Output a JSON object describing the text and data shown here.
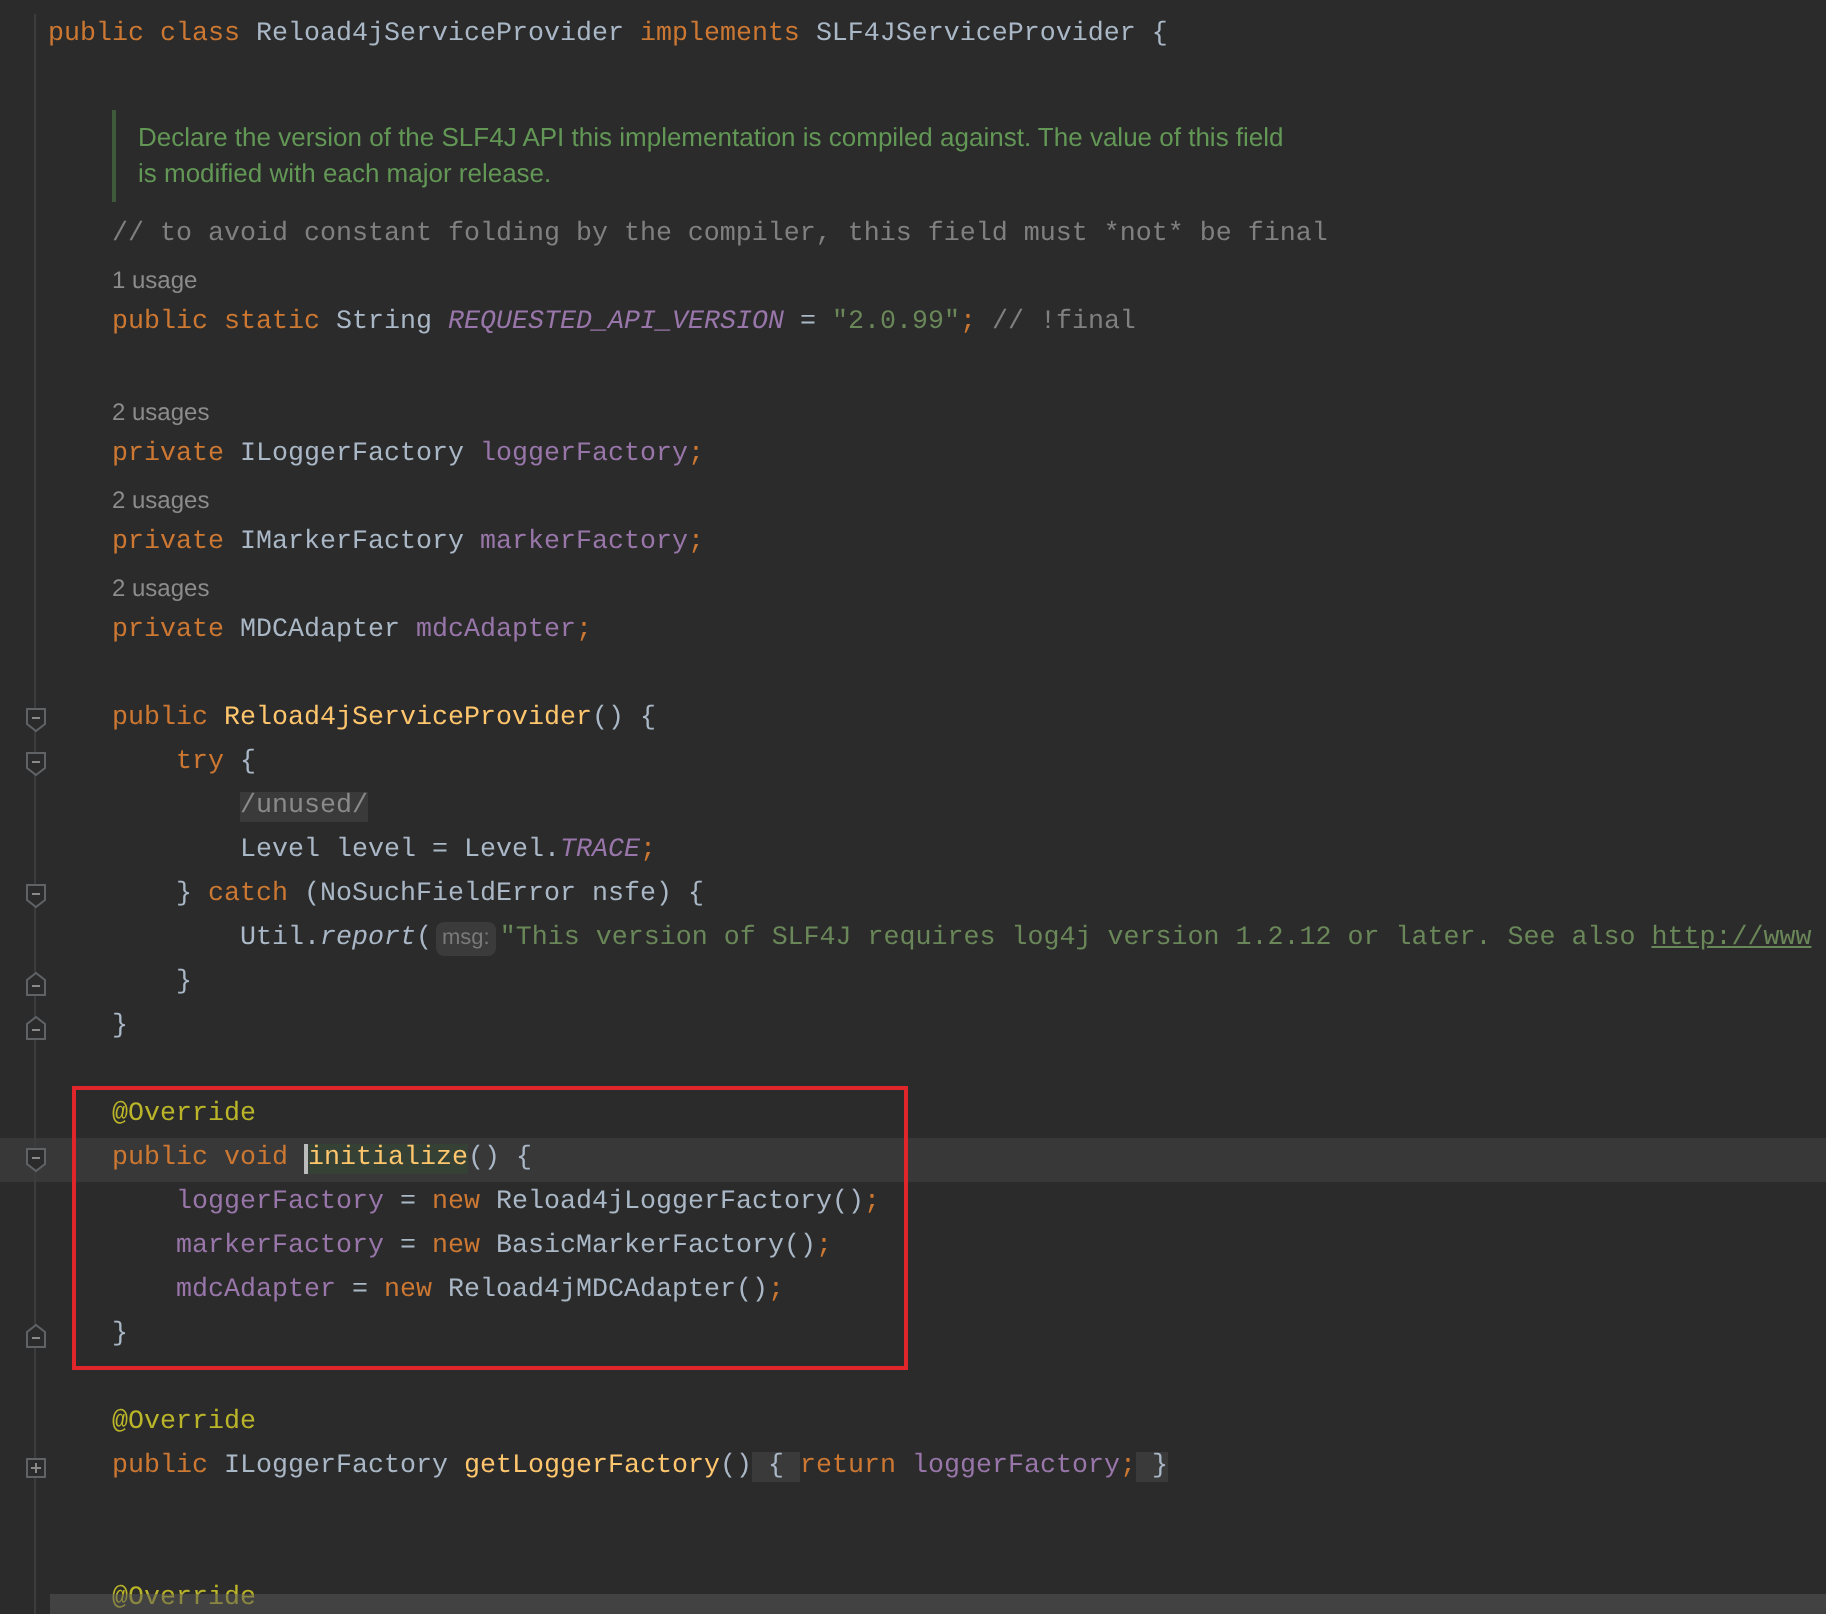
{
  "editor": {
    "lines": [
      {
        "kind": "code",
        "current": false,
        "tokens": [
          {
            "kind": "keyword",
            "text": "public class "
          },
          {
            "kind": "plain",
            "text": "Reload4jServiceProvider "
          },
          {
            "kind": "keyword",
            "text": "implements "
          },
          {
            "kind": "plain",
            "text": "SLF4JServiceProvider {"
          }
        ],
        "children": [
          {
            "kind": "doc",
            "lines": [
              "Declare the version of the SLF4J API this implementation is compiled against. The value of this field",
              "is modified with each major release."
            ]
          },
          {
            "kind": "code",
            "current": false,
            "tokens": [
              {
                "kind": "comment",
                "text": "// to avoid constant folding by the compiler, this field must *not* be final"
              }
            ]
          },
          {
            "kind": "usage",
            "text": "1 usage"
          },
          {
            "kind": "code",
            "current": false,
            "tokens": [
              {
                "kind": "keyword",
                "text": "public static "
              },
              {
                "kind": "plain",
                "text": "String "
              },
              {
                "kind": "static",
                "text": "REQUESTED_API_VERSION"
              },
              {
                "kind": "plain",
                "text": " = "
              },
              {
                "kind": "string",
                "text": "\"2.0.99\""
              },
              {
                "kind": "semicolon",
                "text": ";"
              },
              {
                "kind": "comment",
                "text": " // !final"
              }
            ]
          },
          {
            "kind": "blank"
          },
          {
            "kind": "usage",
            "text": "2 usages"
          },
          {
            "kind": "code",
            "current": false,
            "tokens": [
              {
                "kind": "keyword",
                "text": "private "
              },
              {
                "kind": "plain",
                "text": "ILoggerFactory "
              },
              {
                "kind": "field",
                "text": "loggerFactory"
              },
              {
                "kind": "semicolon",
                "text": ";"
              }
            ]
          },
          {
            "kind": "usage",
            "text": "2 usages"
          },
          {
            "kind": "code",
            "current": false,
            "tokens": [
              {
                "kind": "keyword",
                "text": "private "
              },
              {
                "kind": "plain",
                "text": "IMarkerFactory "
              },
              {
                "kind": "field",
                "text": "markerFactory"
              },
              {
                "kind": "semicolon",
                "text": ";"
              }
            ]
          },
          {
            "kind": "usage",
            "text": "2 usages"
          },
          {
            "kind": "code",
            "current": false,
            "tokens": [
              {
                "kind": "keyword",
                "text": "private "
              },
              {
                "kind": "plain",
                "text": "MDCAdapter "
              },
              {
                "kind": "field",
                "text": "mdcAdapter"
              },
              {
                "kind": "semicolon",
                "text": ";"
              }
            ]
          },
          {
            "kind": "blank"
          },
          {
            "kind": "code",
            "current": false,
            "fold": {
              "kind": "open"
            },
            "tokens": [
              {
                "kind": "keyword",
                "text": "public "
              },
              {
                "kind": "declaration",
                "text": "Reload4jServiceProvider"
              },
              {
                "kind": "plain",
                "text": "() {"
              }
            ],
            "children": [
              {
                "kind": "code",
                "current": false,
                "fold": {
                  "kind": "open"
                },
                "tokens": [
                  {
                    "kind": "keyword",
                    "text": "try "
                  },
                  {
                    "kind": "plain",
                    "text": "{"
                  }
                ],
                "children": [
                  {
                    "kind": "code",
                    "current": false,
                    "tokens": [
                      {
                        "kind": "unused",
                        "text": "/unused/"
                      }
                    ]
                  },
                  {
                    "kind": "code",
                    "current": false,
                    "tokens": [
                      {
                        "kind": "plain",
                        "text": "Level level = Level."
                      },
                      {
                        "kind": "static",
                        "text": "TRACE"
                      },
                      {
                        "kind": "semicolon",
                        "text": ";"
                      }
                    ]
                  }
                ]
              },
              {
                "kind": "code",
                "current": false,
                "fold": {
                  "kind": "open"
                },
                "tokens": [
                  {
                    "kind": "plain",
                    "text": "} "
                  },
                  {
                    "kind": "keyword",
                    "text": "catch "
                  },
                  {
                    "kind": "plain",
                    "text": "(NoSuchFieldError nsfe) {"
                  }
                ],
                "children": [
                  {
                    "kind": "code",
                    "current": false,
                    "tokens": [
                      {
                        "kind": "plain",
                        "text": "Util."
                      },
                      {
                        "kind": "call",
                        "text": "report"
                      },
                      {
                        "kind": "plain",
                        "text": "("
                      },
                      {
                        "kind": "hint",
                        "text": "msg:"
                      },
                      {
                        "kind": "string",
                        "text": "\"This version of SLF4J requires log4j version 1.2.12 or later. See also "
                      },
                      {
                        "kind": "link",
                        "text": "http://www"
                      }
                    ]
                  }
                ]
              },
              {
                "kind": "code",
                "current": false,
                "fold": {
                  "kind": "close"
                },
                "tokens": [
                  {
                    "kind": "plain",
                    "text": "}"
                  }
                ]
              }
            ]
          },
          {
            "kind": "code",
            "current": false,
            "fold": {
              "kind": "close"
            },
            "tokens": [
              {
                "kind": "plain",
                "text": "}"
              }
            ]
          },
          {
            "kind": "blank"
          },
          {
            "kind": "group",
            "boxed": true,
            "lines": [
              {
                "kind": "code",
                "current": false,
                "tokens": [
                  {
                    "kind": "annotation",
                    "text": "@Override"
                  }
                ]
              },
              {
                "kind": "code",
                "current": true,
                "fold": {
                  "kind": "open"
                },
                "tokens": [
                  {
                    "kind": "keyword",
                    "text": "public void "
                  },
                  {
                    "kind": "match",
                    "text": "initialize"
                  },
                  {
                    "kind": "plain",
                    "text": "() {"
                  }
                ],
                "children": [
                  {
                    "kind": "code",
                    "current": false,
                    "tokens": [
                      {
                        "kind": "field",
                        "text": "loggerFactory"
                      },
                      {
                        "kind": "plain",
                        "text": " = "
                      },
                      {
                        "kind": "keyword",
                        "text": "new "
                      },
                      {
                        "kind": "plain",
                        "text": "Reload4jLoggerFactory()"
                      },
                      {
                        "kind": "semicolon",
                        "text": ";"
                      }
                    ]
                  },
                  {
                    "kind": "code",
                    "current": false,
                    "tokens": [
                      {
                        "kind": "field",
                        "text": "markerFactory"
                      },
                      {
                        "kind": "plain",
                        "text": " = "
                      },
                      {
                        "kind": "keyword",
                        "text": "new "
                      },
                      {
                        "kind": "plain",
                        "text": "BasicMarkerFactory()"
                      },
                      {
                        "kind": "semicolon",
                        "text": ";"
                      }
                    ]
                  },
                  {
                    "kind": "code",
                    "current": false,
                    "tokens": [
                      {
                        "kind": "field",
                        "text": "mdcAdapter"
                      },
                      {
                        "kind": "plain",
                        "text": " = "
                      },
                      {
                        "kind": "keyword",
                        "text": "new "
                      },
                      {
                        "kind": "plain",
                        "text": "Reload4jMDCAdapter()"
                      },
                      {
                        "kind": "semicolon",
                        "text": ";"
                      }
                    ]
                  }
                ]
              },
              {
                "kind": "code",
                "current": false,
                "fold": {
                  "kind": "close"
                },
                "tokens": [
                  {
                    "kind": "plain",
                    "text": "}"
                  }
                ]
              }
            ]
          },
          {
            "kind": "blank"
          },
          {
            "kind": "code",
            "current": false,
            "tokens": [
              {
                "kind": "annotation",
                "text": "@Override"
              }
            ]
          },
          {
            "kind": "code",
            "current": false,
            "fold": {
              "kind": "collapsed"
            },
            "tokens": [
              {
                "kind": "keyword",
                "text": "public "
              },
              {
                "kind": "plain",
                "text": "ILoggerFactory "
              },
              {
                "kind": "declaration",
                "text": "getLoggerFactory"
              },
              {
                "kind": "plain",
                "text": "()"
              },
              {
                "kind": "folded",
                "text": " { "
              },
              {
                "kind": "keyword",
                "text": "return "
              },
              {
                "kind": "field",
                "text": "loggerFactory"
              },
              {
                "kind": "semicolon",
                "text": ";"
              },
              {
                "kind": "folded",
                "text": " }"
              }
            ]
          },
          {
            "kind": "blank"
          },
          {
            "kind": "blank"
          },
          {
            "kind": "code",
            "current": false,
            "tokens": [
              {
                "kind": "annotation",
                "text": "@Override"
              }
            ]
          }
        ]
      }
    ]
  }
}
